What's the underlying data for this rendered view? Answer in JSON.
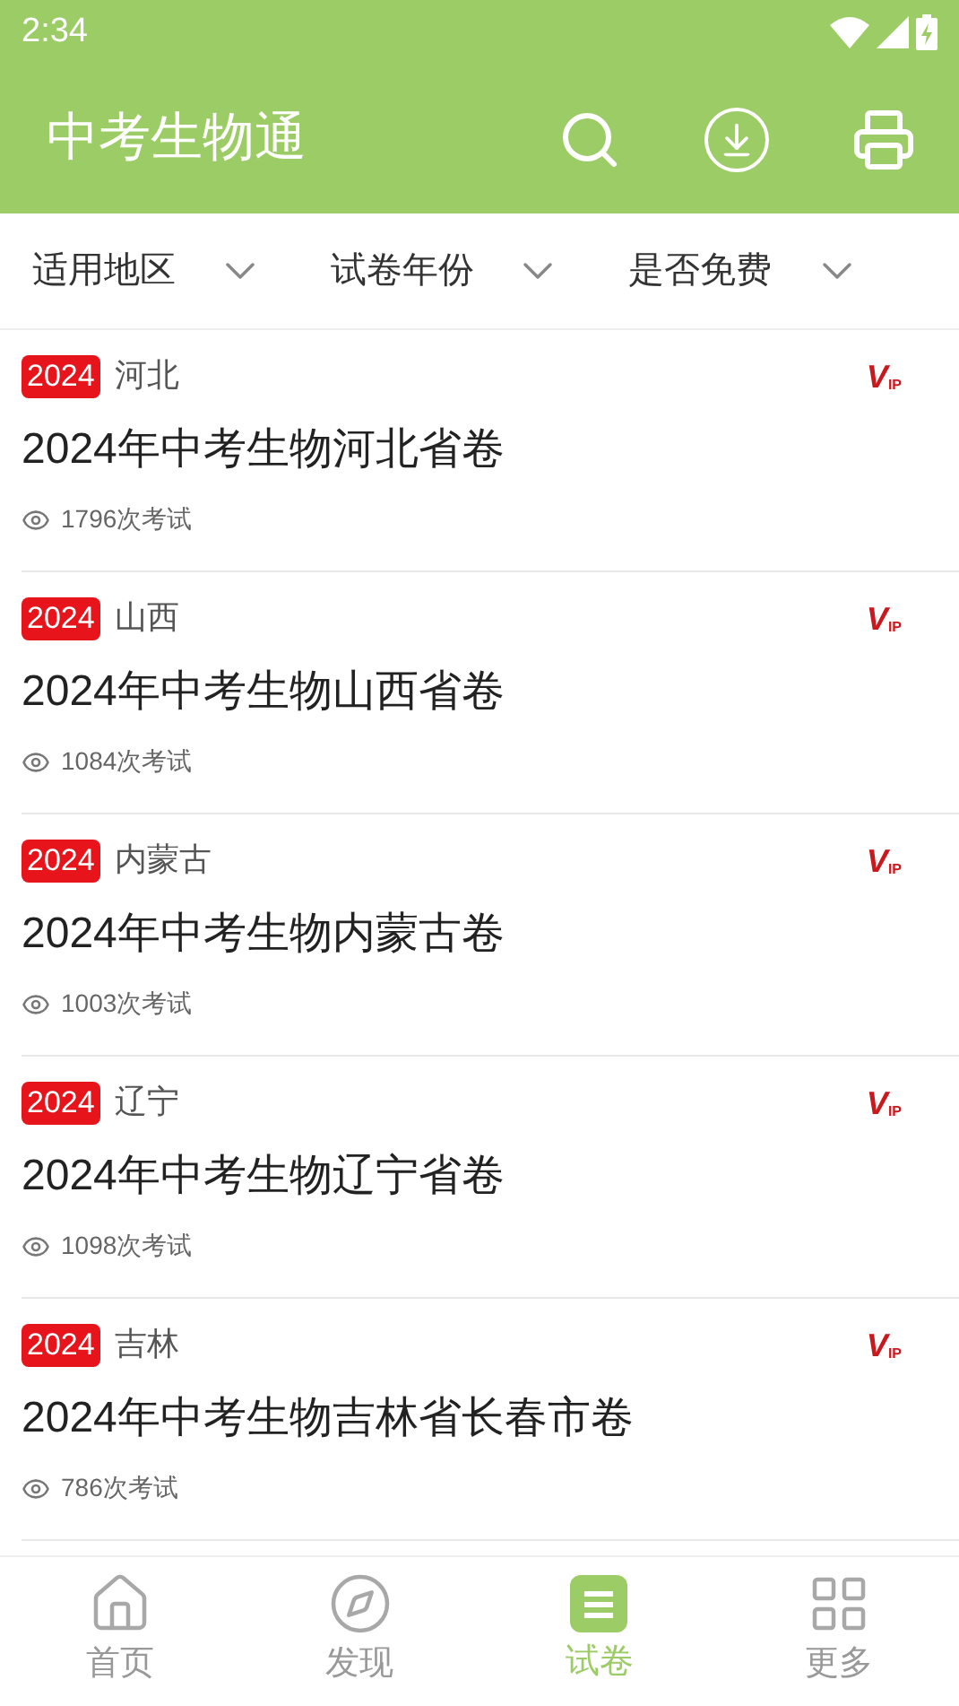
{
  "status_bar": {
    "time": "2:34"
  },
  "app_bar": {
    "title": "中考生物通"
  },
  "filters": [
    {
      "label": "适用地区"
    },
    {
      "label": "试卷年份"
    },
    {
      "label": "是否免费"
    }
  ],
  "papers": [
    {
      "year": "2024",
      "region": "河北",
      "title": "2024年中考生物河北省卷",
      "views": "1796次考试",
      "badge": "VIP"
    },
    {
      "year": "2024",
      "region": "山西",
      "title": "2024年中考生物山西省卷",
      "views": "1084次考试",
      "badge": "VIP"
    },
    {
      "year": "2024",
      "region": "内蒙古",
      "title": "2024年中考生物内蒙古卷",
      "views": "1003次考试",
      "badge": "VIP"
    },
    {
      "year": "2024",
      "region": "辽宁",
      "title": "2024年中考生物辽宁省卷",
      "views": "1098次考试",
      "badge": "VIP"
    },
    {
      "year": "2024",
      "region": "吉林",
      "title": "2024年中考生物吉林省长春市卷",
      "views": "786次考试",
      "badge": "VIP"
    }
  ],
  "tabs": [
    {
      "label": "首页",
      "kind": "home",
      "selected": false
    },
    {
      "label": "发现",
      "kind": "discover",
      "selected": false
    },
    {
      "label": "试卷",
      "kind": "papers",
      "selected": true
    },
    {
      "label": "更多",
      "kind": "more",
      "selected": false
    }
  ]
}
